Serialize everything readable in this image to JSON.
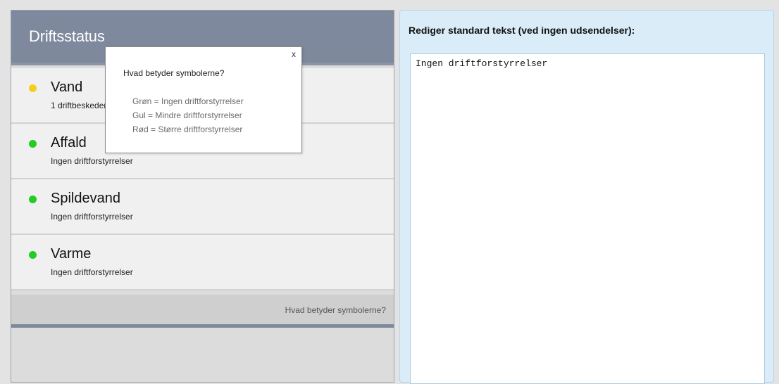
{
  "status": {
    "title": "Driftsstatus",
    "items": [
      {
        "name": "Vand",
        "desc": "1 driftbeskeder",
        "color": "#f2cf1c"
      },
      {
        "name": "Affald",
        "desc": "Ingen driftforstyrrelser",
        "color": "#22cc22"
      },
      {
        "name": "Spildevand",
        "desc": "Ingen driftforstyrrelser",
        "color": "#22cc22"
      },
      {
        "name": "Varme",
        "desc": "Ingen driftforstyrrelser",
        "color": "#22cc22"
      }
    ],
    "legend_link": "Hvad betyder symbolerne?"
  },
  "popup": {
    "close": "x",
    "title": "Hvad betyder symbolerne?",
    "lines": [
      "Grøn = Ingen driftforstyrrelser",
      "Gul = Mindre driftforstyrrelser",
      "Rød = Større driftforstyrrelser"
    ]
  },
  "editor": {
    "title": "Rediger standard tekst (ved ingen udsendelser):",
    "text": "Ingen driftforstyrrelser"
  }
}
